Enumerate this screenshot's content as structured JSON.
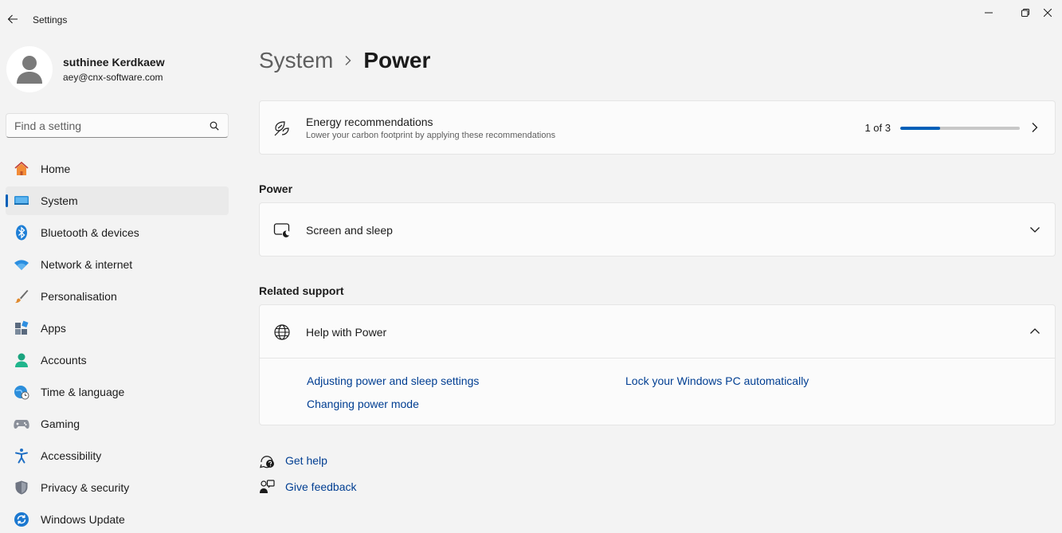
{
  "window": {
    "title": "Settings"
  },
  "profile": {
    "name": "suthinee Kerdkaew",
    "email": "aey@cnx-software.com"
  },
  "search": {
    "placeholder": "Find a setting"
  },
  "nav": {
    "items": [
      {
        "label": "Home",
        "icon": "home-icon"
      },
      {
        "label": "System",
        "icon": "monitor-icon",
        "active": true
      },
      {
        "label": "Bluetooth & devices",
        "icon": "bluetooth-icon"
      },
      {
        "label": "Network & internet",
        "icon": "wifi-icon"
      },
      {
        "label": "Personalisation",
        "icon": "brush-icon"
      },
      {
        "label": "Apps",
        "icon": "apps-icon"
      },
      {
        "label": "Accounts",
        "icon": "person-icon"
      },
      {
        "label": "Time & language",
        "icon": "globe-clock-icon"
      },
      {
        "label": "Gaming",
        "icon": "gamepad-icon"
      },
      {
        "label": "Accessibility",
        "icon": "accessibility-icon"
      },
      {
        "label": "Privacy & security",
        "icon": "shield-icon"
      },
      {
        "label": "Windows Update",
        "icon": "update-icon"
      }
    ]
  },
  "breadcrumb": {
    "parent": "System",
    "current": "Power"
  },
  "energy": {
    "title": "Energy recommendations",
    "subtitle": "Lower your carbon footprint by applying these recommendations",
    "progress_text": "1 of 3",
    "progress_fraction": 0.333
  },
  "power_section": {
    "title": "Power",
    "screen_sleep_label": "Screen and sleep"
  },
  "related_support": {
    "title": "Related support",
    "help_title": "Help with Power",
    "links": [
      "Adjusting power and sleep settings",
      "Lock your Windows PC automatically",
      "Changing power mode"
    ]
  },
  "footer": {
    "get_help": "Get help",
    "give_feedback": "Give feedback"
  },
  "colors": {
    "accent": "#005fb8",
    "link": "#003e92",
    "background": "#f3f3f3",
    "card": "#fbfbfb"
  }
}
